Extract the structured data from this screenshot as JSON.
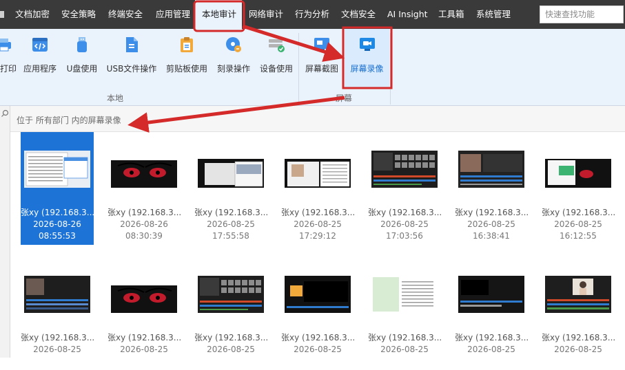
{
  "menubar": {
    "items": [
      {
        "label": "文档加密"
      },
      {
        "label": "安全策略"
      },
      {
        "label": "终端安全"
      },
      {
        "label": "应用管理"
      },
      {
        "label": "本地审计",
        "active": true
      },
      {
        "label": "网络审计"
      },
      {
        "label": "行为分析"
      },
      {
        "label": "文档安全"
      },
      {
        "label": "AI Insight"
      },
      {
        "label": "工具箱"
      },
      {
        "label": "系统管理"
      }
    ],
    "search_placeholder": "快速查找功能"
  },
  "ribbon": {
    "local_buttons": [
      {
        "label": "打印",
        "icon": "printer-icon"
      },
      {
        "label": "应用程序",
        "icon": "app-icon"
      },
      {
        "label": "U盘使用",
        "icon": "usb-icon"
      },
      {
        "label": "USB文件操作",
        "icon": "usb-file-icon"
      },
      {
        "label": "剪贴板使用",
        "icon": "clipboard-icon"
      },
      {
        "label": "刻录操作",
        "icon": "disc-burn-icon"
      },
      {
        "label": "设备使用",
        "icon": "device-icon"
      }
    ],
    "screen_buttons": [
      {
        "label": "屏幕截图",
        "icon": "screenshot-icon"
      },
      {
        "label": "屏幕录像",
        "icon": "screen-record-icon",
        "selected": true
      }
    ],
    "group_local": "本地",
    "group_screen": "屏幕"
  },
  "path_text": "位于 所有部门 内的屏幕录像",
  "recordings": [
    {
      "name": "张xy (192.168.3...",
      "date": "2026-08-26",
      "time": "08:55:53",
      "thumb": "desktop-window",
      "selected": true
    },
    {
      "name": "张xy (192.168.3...",
      "date": "2026-08-26",
      "time": "08:30:39",
      "thumb": "anime-eyes"
    },
    {
      "name": "张xy (192.168.3...",
      "date": "2026-08-25",
      "time": "17:55:58",
      "thumb": "anime-windows"
    },
    {
      "name": "张xy (192.168.3...",
      "date": "2026-08-25",
      "time": "17:29:12",
      "thumb": "anime-windows2"
    },
    {
      "name": "张xy (192.168.3...",
      "date": "2026-08-25",
      "time": "17:03:56",
      "thumb": "video-editor"
    },
    {
      "name": "张xy (192.168.3...",
      "date": "2026-08-25",
      "time": "16:38:41",
      "thumb": "video-editor-face"
    },
    {
      "name": "张xy (192.168.3...",
      "date": "2026-08-25",
      "time": "16:12:55",
      "thumb": "anime-window-green"
    },
    {
      "name": "张xy (192.168.3...",
      "date": "2026-08-25",
      "time": "",
      "thumb": "editor-face-left"
    },
    {
      "name": "张xy (192.168.3...",
      "date": "2026-08-25",
      "time": "",
      "thumb": "anime-eyes"
    },
    {
      "name": "张xy (192.168.3...",
      "date": "2026-08-25",
      "time": "",
      "thumb": "video-editor"
    },
    {
      "name": "张xy (192.168.3...",
      "date": "2026-08-25",
      "time": "",
      "thumb": "editor-orange"
    },
    {
      "name": "张xy (192.168.3...",
      "date": "2026-08-25",
      "time": "",
      "thumb": "document-green"
    },
    {
      "name": "张xy (192.168.3...",
      "date": "2026-08-25",
      "time": "",
      "thumb": "editor-dark"
    },
    {
      "name": "张xy (192.168.3...",
      "date": "2026-08-25",
      "time": "",
      "thumb": "editor-person"
    }
  ],
  "colors": {
    "menubar_bg": "#3a3a3a",
    "ribbon_bg": "#eaf2fc",
    "selection": "#1e73d6",
    "annotation_red": "#d42a2a"
  }
}
